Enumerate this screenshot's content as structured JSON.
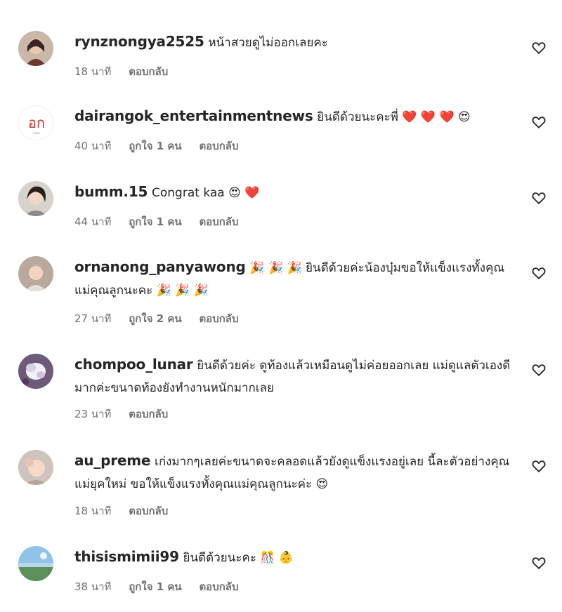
{
  "comments": [
    {
      "username": "rynznongya2525",
      "text": "หน้าสวยดูไม่ออกเลยคะ",
      "time": "18 นาที",
      "likes": "",
      "reply": "ตอบกลับ"
    },
    {
      "username": "dairangok_entertainmentnews",
      "text": "ยินดีด้วยนะคะพี่ ❤️ ❤️ ❤️ 😍",
      "time": "40 นาที",
      "likes": "ถูกใจ 1 คน",
      "reply": "ตอบกลับ"
    },
    {
      "username": "bumm.15",
      "text": "Congrat kaa 😍 ❤️",
      "time": "44 นาที",
      "likes": "ถูกใจ 1 คน",
      "reply": "ตอบกลับ"
    },
    {
      "username": "ornanong_panyawong",
      "text": "🎉 🎉 🎉 ยินดีด้วยค่ะน้องบุ๋มขอให้แข็งแรงทั้งคุณแม่คุณลูกนะคะ 🎉 🎉 🎉",
      "time": "27 นาที",
      "likes": "ถูกใจ 2 คน",
      "reply": "ตอบกลับ"
    },
    {
      "username": "chompoo_lunar",
      "text": "ยินดีด้วยค่ะ ดูท้องแล้วเหมือนดูไม่ค่อยออกเลย แม่ดูแลตัวเองดีมากค่ะขนาดท้องยังทำงานหนักมากเลย",
      "time": "23 นาที",
      "likes": "",
      "reply": "ตอบกลับ"
    },
    {
      "username": "au_preme",
      "text": "เก่งมากๆเลยค่ะขนาดจะคลอดแล้วยังดูแข็งแรงอยู่เลย นี้ละตัวอย่างคุณแม่ยุคใหม่ ขอให้แข็งแรงทั้งคุณแม่คุณลูกนะค่ะ 😍",
      "time": "18 นาที",
      "likes": "",
      "reply": "ตอบกลับ"
    },
    {
      "username": "thisismimii99",
      "text": "ยินดีด้วยนะคะ 🎊 👶",
      "time": "38 นาที",
      "likes": "ถูกใจ 1 คน",
      "reply": "ตอบกลับ"
    }
  ]
}
